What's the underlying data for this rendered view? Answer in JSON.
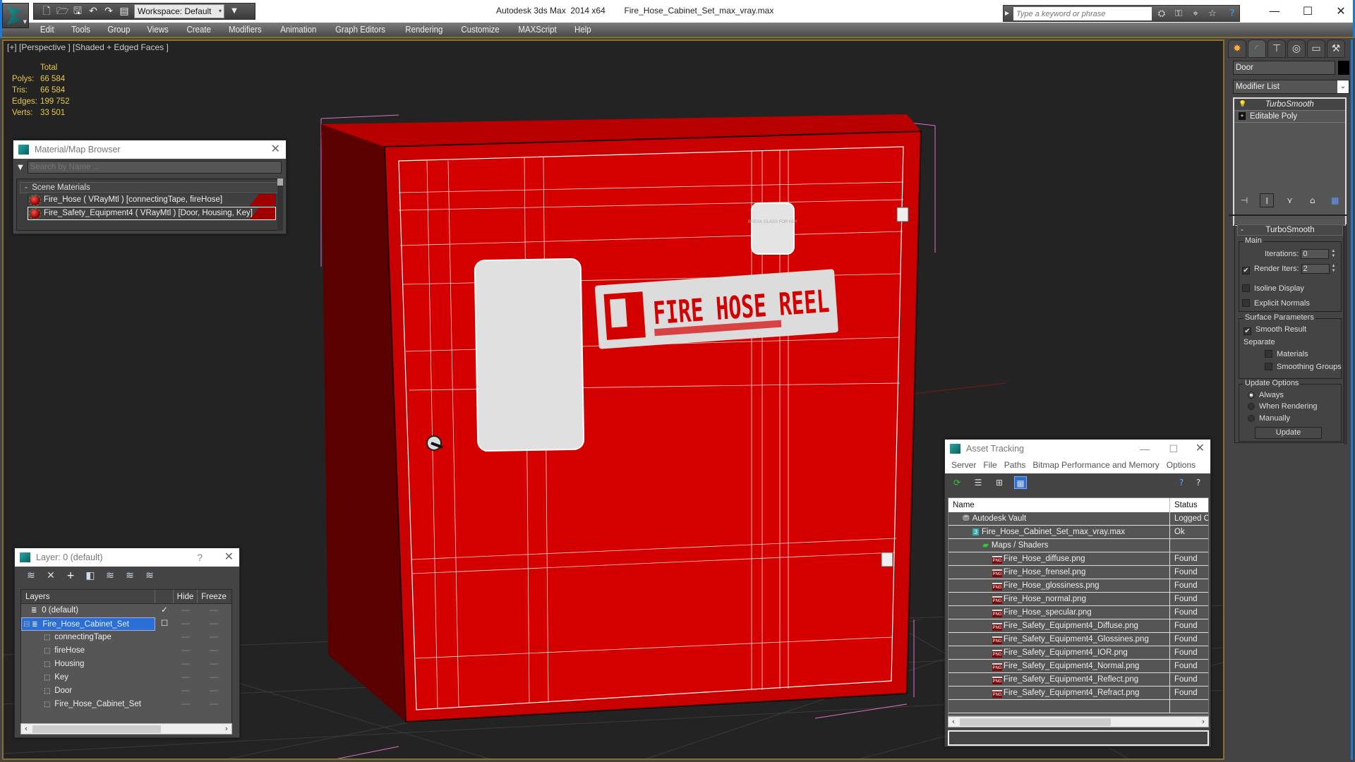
{
  "titlebar": {
    "app_name": "Autodesk 3ds Max  2014 x64",
    "file_name": "Fire_Hose_Cabinet_Set_max_vray.max",
    "workspace": "Workspace: Default",
    "search_placeholder": "Type a keyword or phrase",
    "icons": [
      "binoculars-icon",
      "key-icon",
      "satellite-icon",
      "star-icon",
      "help-icon"
    ]
  },
  "menu": [
    "Edit",
    "Tools",
    "Group",
    "Views",
    "Create",
    "Modifiers",
    "Animation",
    "Graph Editors",
    "Rendering",
    "Customize",
    "MAXScript",
    "Help"
  ],
  "viewport": {
    "label": "[+] [Perspective ] [Shaded + Edged Faces ]",
    "stats": {
      "header": "Total",
      "rows": [
        {
          "label": "Polys:",
          "value": "66 584"
        },
        {
          "label": "Tris:",
          "value": "66 584"
        },
        {
          "label": "Edges:",
          "value": "199 752"
        },
        {
          "label": "Verts:",
          "value": "33 501"
        }
      ]
    },
    "model": {
      "sign_text": "FIRE HOSE REEL",
      "key_box_text": "BREAK GLASS FOR KEY",
      "color": "#d40000"
    }
  },
  "material_browser": {
    "title": "Material/Map Browser",
    "search_placeholder": "Search by Name ...",
    "group": "Scene Materials",
    "group_toggle": "-",
    "items": [
      {
        "label": "Fire_Hose  ( VRayMtl )  [connectingTape, fireHose]",
        "selected": false
      },
      {
        "label": "Fire_Safety_Equipment4  ( VRayMtl )  [Door, Housing, Key]",
        "selected": true
      }
    ]
  },
  "layer_panel": {
    "title": "Layer: 0 (default)",
    "help": "?",
    "columns": [
      "Layers",
      "",
      "Hide",
      "Freeze"
    ],
    "rows": [
      {
        "name": "0 (default)",
        "level": 0,
        "type": "layer",
        "current": "✓",
        "selected": false,
        "hide": "—",
        "freeze": "—"
      },
      {
        "name": "Fire_Hose_Cabinet_Set",
        "level": 0,
        "type": "layer",
        "expand": "⊟",
        "current": "☐",
        "selected": true,
        "hide": "—",
        "freeze": "—"
      },
      {
        "name": "connectingTape",
        "level": 1,
        "type": "object",
        "current": "",
        "selected": false,
        "hide": "—",
        "freeze": "—"
      },
      {
        "name": "fireHose",
        "level": 1,
        "type": "object",
        "current": "",
        "selected": false,
        "hide": "—",
        "freeze": "—"
      },
      {
        "name": "Housing",
        "level": 1,
        "type": "object",
        "current": "",
        "selected": false,
        "hide": "—",
        "freeze": "—"
      },
      {
        "name": "Key",
        "level": 1,
        "type": "object",
        "current": "",
        "selected": false,
        "hide": "—",
        "freeze": "—"
      },
      {
        "name": "Door",
        "level": 1,
        "type": "object",
        "current": "",
        "selected": false,
        "hide": "—",
        "freeze": "—"
      },
      {
        "name": "Fire_Hose_Cabinet_Set",
        "level": 1,
        "type": "object",
        "current": "",
        "selected": false,
        "hide": "—",
        "freeze": "—"
      }
    ]
  },
  "asset_tracking": {
    "title": "Asset Tracking",
    "menu": [
      "Server",
      "File",
      "Paths",
      "Bitmap Performance and Memory",
      "Options"
    ],
    "columns": [
      "Name",
      "Status"
    ],
    "rows": [
      {
        "name": "Autodesk Vault",
        "indent": 1,
        "icon": "vault",
        "status": "Logged O"
      },
      {
        "name": "Fire_Hose_Cabinet_Set_max_vray.max",
        "indent": 2,
        "icon": "max",
        "status": "Ok"
      },
      {
        "name": "Maps / Shaders",
        "indent": 3,
        "icon": "maps",
        "status": ""
      },
      {
        "name": "Fire_Hose_diffuse.png",
        "indent": 4,
        "icon": "png",
        "status": "Found"
      },
      {
        "name": "Fire_Hose_frensel.png",
        "indent": 4,
        "icon": "png",
        "status": "Found"
      },
      {
        "name": "Fire_Hose_glossiness.png",
        "indent": 4,
        "icon": "png",
        "status": "Found"
      },
      {
        "name": "Fire_Hose_normal.png",
        "indent": 4,
        "icon": "png",
        "status": "Found"
      },
      {
        "name": "Fire_Hose_specular.png",
        "indent": 4,
        "icon": "png",
        "status": "Found"
      },
      {
        "name": "Fire_Safety_Equipment4_Diffuse.png",
        "indent": 4,
        "icon": "png",
        "status": "Found"
      },
      {
        "name": "Fire_Safety_Equipment4_Glossines.png",
        "indent": 4,
        "icon": "png",
        "status": "Found"
      },
      {
        "name": "Fire_Safety_Equipment4_IOR.png",
        "indent": 4,
        "icon": "png",
        "status": "Found"
      },
      {
        "name": "Fire_Safety_Equipment4_Normal.png",
        "indent": 4,
        "icon": "png",
        "status": "Found"
      },
      {
        "name": "Fire_Safety_Equipment4_Reflect.png",
        "indent": 4,
        "icon": "png",
        "status": "Found"
      },
      {
        "name": "Fire_Safety_Equipment4_Refract.png",
        "indent": 4,
        "icon": "png",
        "status": "Found"
      }
    ],
    "png_badge": "PNG"
  },
  "command_panel": {
    "object_name": "Door",
    "modifier_list": "Modifier List",
    "stack": [
      {
        "label": "TurboSmooth",
        "selected": true
      },
      {
        "label": "Editable Poly",
        "selected": false
      }
    ],
    "rollout_title": "TurboSmooth",
    "rollout_toggle": "-",
    "main_group": "Main",
    "iterations_label": "Iterations:",
    "iterations_value": "0",
    "render_iters_label": "Render Iters:",
    "render_iters_value": "2",
    "render_iters_checked": true,
    "isoline_label": "Isoline Display",
    "isoline_checked": false,
    "explicit_normals_label": "Explicit Normals",
    "explicit_normals_checked": false,
    "surface_group": "Surface Parameters",
    "smooth_result_label": "Smooth Result",
    "smooth_result_checked": true,
    "separate_label": "Separate",
    "materials_label": "Materials",
    "smoothing_groups_label": "Smoothing Groups",
    "update_group": "Update Options",
    "update_options": [
      "Always",
      "When Rendering",
      "Manually"
    ],
    "update_selected": "Always",
    "update_button": "Update"
  }
}
